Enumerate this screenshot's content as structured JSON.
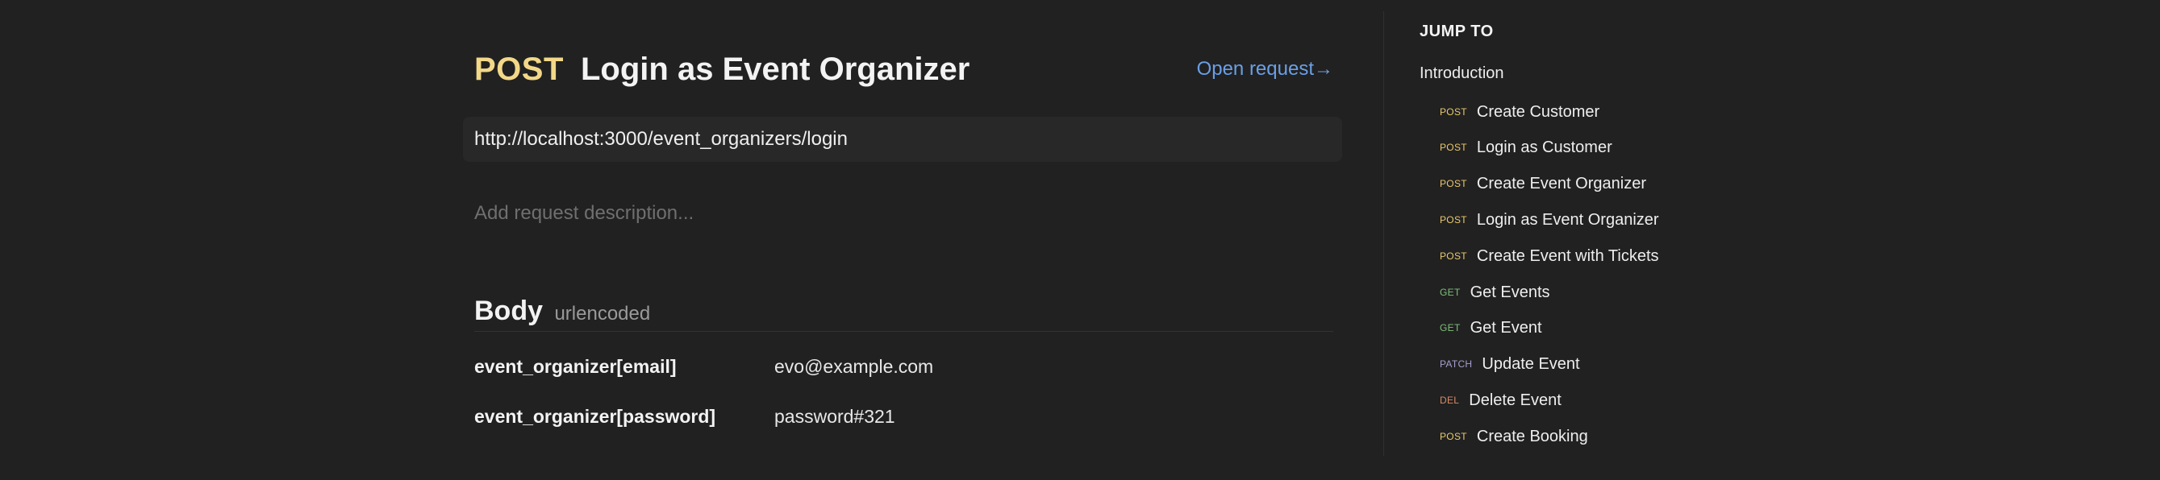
{
  "request": {
    "method": "POST",
    "title": "Login as Event Organizer",
    "open_request_label": "Open request→",
    "url": "http://localhost:3000/event_organizers/login",
    "description_placeholder": "Add request description..."
  },
  "body": {
    "label": "Body",
    "encoding": "urlencoded",
    "params": [
      {
        "key": "event_organizer[email]",
        "value": "evo@example.com"
      },
      {
        "key": "event_organizer[password]",
        "value": "password#321"
      }
    ]
  },
  "sidebar": {
    "heading": "JUMP TO",
    "intro_label": "Introduction",
    "items": [
      {
        "method": "POST",
        "label": "Create Customer"
      },
      {
        "method": "POST",
        "label": "Login as Customer"
      },
      {
        "method": "POST",
        "label": "Create Event Organizer"
      },
      {
        "method": "POST",
        "label": "Login as Event Organizer"
      },
      {
        "method": "POST",
        "label": "Create Event with Tickets"
      },
      {
        "method": "GET",
        "label": "Get Events"
      },
      {
        "method": "GET",
        "label": "Get Event"
      },
      {
        "method": "PATCH",
        "label": "Update Event"
      },
      {
        "method": "DEL",
        "label": "Delete Event"
      },
      {
        "method": "POST",
        "label": "Create Booking"
      }
    ]
  },
  "colors": {
    "background": "#212121",
    "post": "#f2d888",
    "get": "#7fbf7a",
    "patch": "#a79fcf",
    "del": "#d98a6a",
    "link": "#6a9fe6"
  }
}
